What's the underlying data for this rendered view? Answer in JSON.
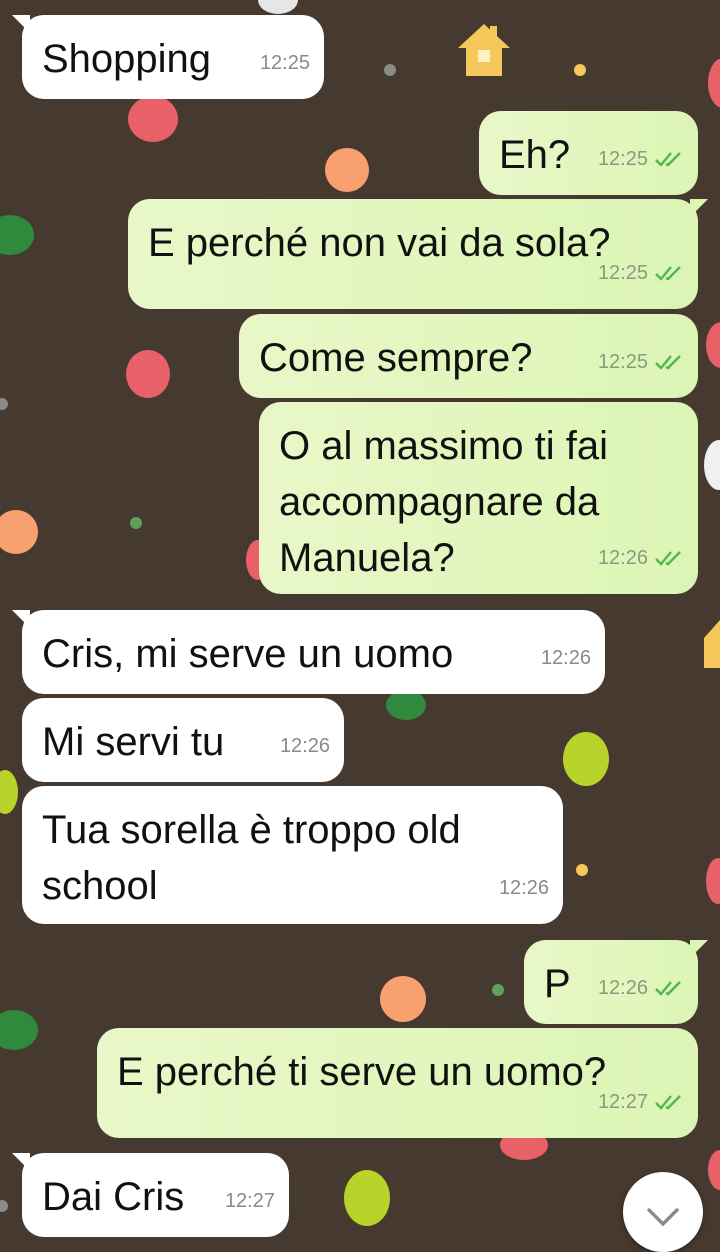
{
  "chat": {
    "messages": [
      {
        "dir": "in",
        "text": "Shopping",
        "time": "12:25"
      },
      {
        "dir": "out",
        "text": "Eh?",
        "time": "12:25"
      },
      {
        "dir": "out",
        "text": "E perché non vai da sola?",
        "time": "12:25"
      },
      {
        "dir": "out",
        "text": "Come sempre?",
        "time": "12:25"
      },
      {
        "dir": "out",
        "text": "O al massimo ti fai\naccompagnare da\nManuela?",
        "time": "12:26"
      },
      {
        "dir": "in",
        "text": "Cris, mi serve un uomo",
        "time": "12:26"
      },
      {
        "dir": "in",
        "text": "Mi servi tu",
        "time": "12:26"
      },
      {
        "dir": "in",
        "text": "Tua sorella è troppo old\nschool",
        "time": "12:26"
      },
      {
        "dir": "out",
        "text": "P",
        "time": "12:26"
      },
      {
        "dir": "out",
        "text": "E perché ti serve un uomo?",
        "time": "12:27"
      },
      {
        "dir": "in",
        "text": "Dai Cris",
        "time": "12:27"
      }
    ]
  },
  "icons": {
    "read_receipt": "double-check-icon",
    "scroll_down": "chevron-down-icon"
  },
  "colors": {
    "wallpaper": "#46392f",
    "incoming_bubble": "#ffffff",
    "outgoing_bubble": "#dcf5b5",
    "read_ticks": "#4fc3f7"
  }
}
